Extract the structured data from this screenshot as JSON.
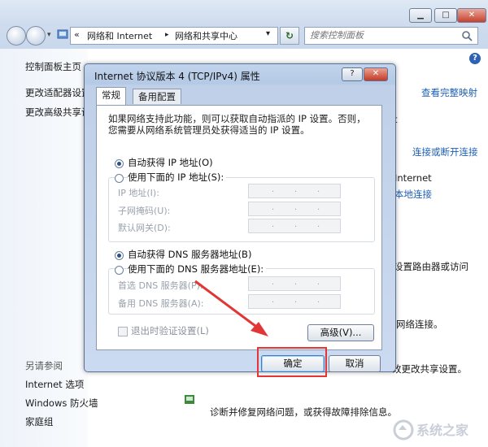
{
  "outer": {
    "window_buttons": {
      "minimize": "▁",
      "maximize": "□",
      "close": "✕"
    },
    "address": {
      "sep": "«",
      "crumb1": "网络和 Internet",
      "arrow": "▸",
      "crumb2": "网络和共享中心",
      "dropdown": "▾",
      "refresh": "↻"
    },
    "search_placeholder": "搜索控制面板",
    "left_pane": {
      "home": "控制面板主页",
      "adapter": "更改适配器设置",
      "advanced": "更改高级共享设",
      "see_also": "另请参阅",
      "internet_options": "Internet 选项",
      "firewall": "Windows 防火墙",
      "homegroup": "家庭组"
    },
    "right_pane": {
      "full_map": "查看完整映射",
      "connect_disconnect": "连接或断开连接",
      "internet": "Internet",
      "local_conn": "本地连接",
      "router_access": "设置路由器或访问",
      "net_conn": "网络连接。",
      "change_share": "改更改共享设置。",
      "diagnose": "诊断并修复网络问题，或获得故障排除信息。",
      "t_fragment": "t"
    },
    "help": "?"
  },
  "dialog": {
    "title": "Internet 协议版本 4 (TCP/IPv4) 属性",
    "help_btn": "?",
    "close_btn": "✕",
    "tabs": [
      "常规",
      "备用配置"
    ],
    "description": [
      "如果网络支持此功能，则可以获取自动指派的 IP 设置。否则，",
      "您需要从网络系统管理员处获得适当的 IP 设置。"
    ],
    "ip_auto": "自动获得 IP 地址(O)",
    "ip_manual": "使用下面的 IP 地址(S):",
    "ip_fields": [
      "IP 地址(I):",
      "子网掩码(U):",
      "默认网关(D):"
    ],
    "dns_auto": "自动获得 DNS 服务器地址(B)",
    "dns_manual": "使用下面的 DNS 服务器地址(E):",
    "dns_fields": [
      "首选 DNS 服务器(P):",
      "备用 DNS 服务器(A):"
    ],
    "ip_placeholder_dots": ".",
    "validate": "退出时验证设置(L)",
    "advanced": "高级(V)...",
    "ok": "确定",
    "cancel": "取消"
  },
  "colors": {
    "annotation": "#e23636",
    "link": "#1d5fb5"
  },
  "watermark": "系统之家"
}
